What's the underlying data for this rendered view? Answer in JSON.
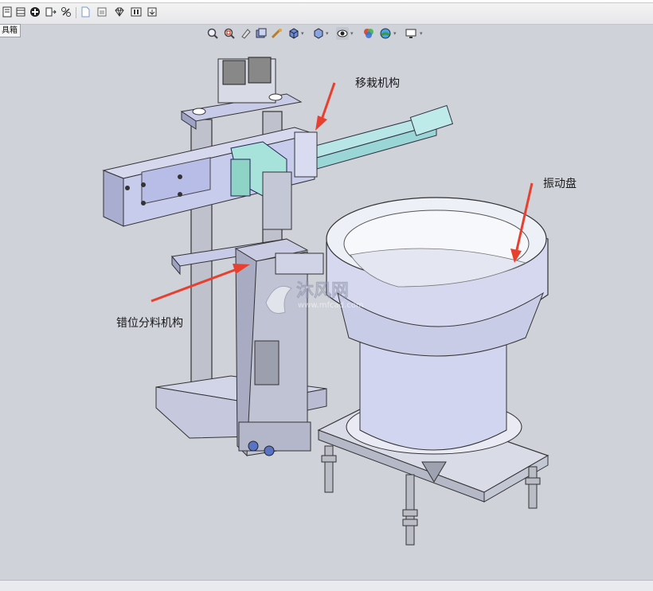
{
  "toolbox_tab": {
    "label": "具箱"
  },
  "toolbar": {
    "icons": [
      "sheet-icon",
      "layout-icon",
      "circle-plus-icon",
      "export-icon",
      "link-icon",
      "document-icon",
      "image-icon",
      "diamond-icon",
      "table-icon",
      "download-icon"
    ]
  },
  "view_toolbar": {
    "icons": [
      "zoom-fit-icon",
      "zoom-area-icon",
      "previous-view-icon",
      "section-view-icon",
      "dynamic-annotation-icon",
      "view-orientation-icon",
      "display-style-icon",
      "hide-show-icon",
      "edit-appearance-icon",
      "apply-scene-icon",
      "view-settings-icon"
    ]
  },
  "annotations": {
    "transfer": "移栽机构",
    "vibratory": "振动盘",
    "staggered": "错位分料机构"
  },
  "watermark": {
    "cn": "沐风网",
    "url": "www.mfcad.com"
  },
  "colors": {
    "arrow": "#e8402f",
    "part_blue": "#c9cdea",
    "part_steel": "#c3c6d0",
    "bowl": "#d4d7ef",
    "viewport_bg": "#cfd2d9"
  }
}
